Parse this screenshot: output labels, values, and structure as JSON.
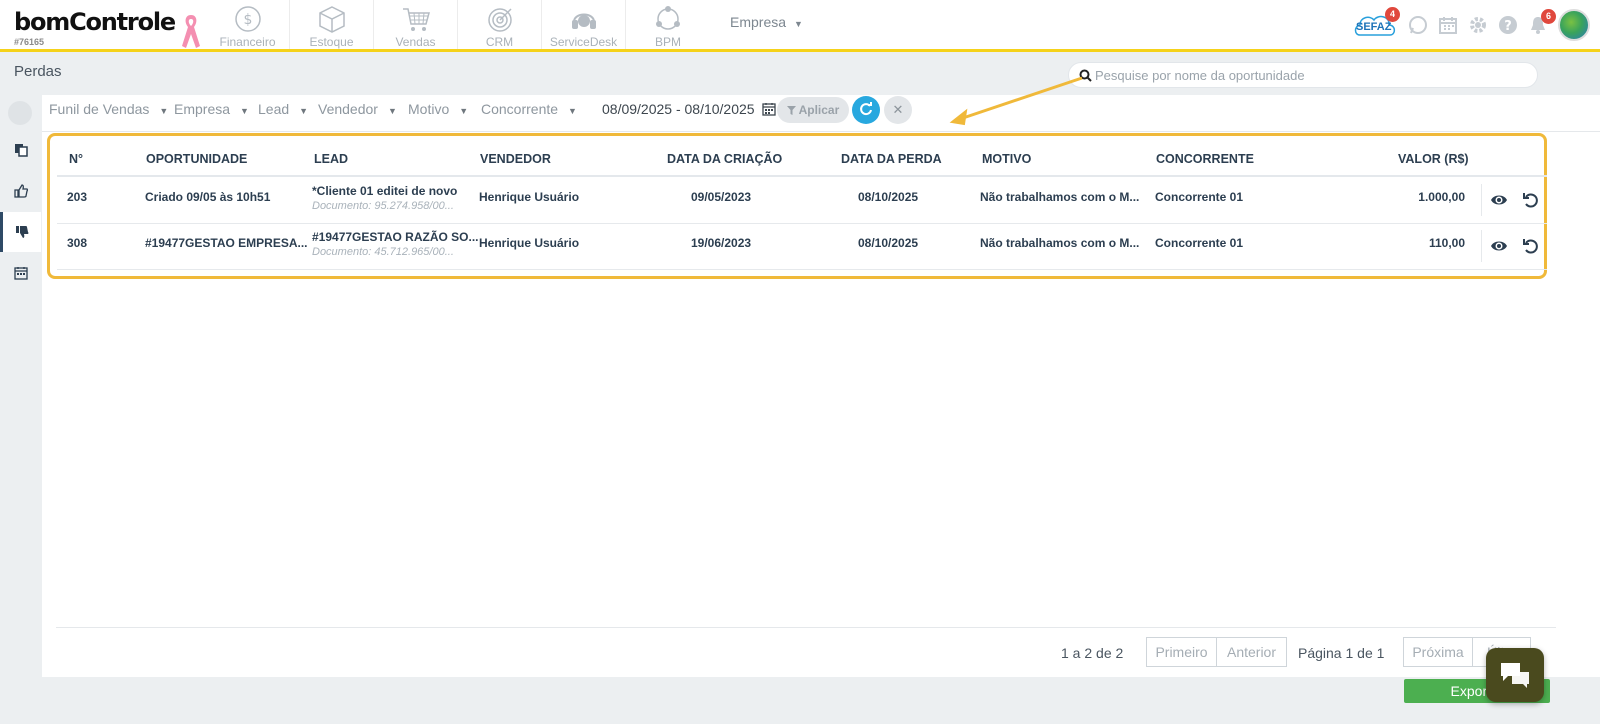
{
  "header": {
    "logo": "bomControle",
    "account_id": "#76165",
    "modules": [
      {
        "label": "Financeiro",
        "icon": "dollar-circle-icon"
      },
      {
        "label": "Estoque",
        "icon": "box-icon"
      },
      {
        "label": "Vendas",
        "icon": "cart-icon"
      },
      {
        "label": "CRM",
        "icon": "target-icon"
      },
      {
        "label": "ServiceDesk",
        "icon": "headset-icon"
      },
      {
        "label": "BPM",
        "icon": "process-icon"
      }
    ],
    "company_menu": "Empresa",
    "sefaz_label": "SEFAZ",
    "sefaz_badge": "4",
    "notifications_badge": "6"
  },
  "page": {
    "title": "Perdas",
    "search_placeholder": "Pesquise por nome da oportunidade"
  },
  "filters": {
    "funnel": "Funil de Vendas",
    "company": "Empresa",
    "lead": "Lead",
    "seller": "Vendedor",
    "reason": "Motivo",
    "competitor": "Concorrente",
    "date_range": "08/09/2025 - 08/10/2025",
    "apply": "Aplicar"
  },
  "table": {
    "columns": {
      "number": "N°",
      "opportunity": "OPORTUNIDADE",
      "lead": "LEAD",
      "seller": "VENDEDOR",
      "created": "DATA DA CRIAÇÃO",
      "lost": "DATA DA PERDA",
      "reason": "MOTIVO",
      "competitor": "CONCORRENTE",
      "value": "VALOR (R$)"
    },
    "rows": [
      {
        "number": "203",
        "opportunity": "Criado 09/05 às 10h51",
        "lead": "*Cliente 01 editei de novo",
        "lead_doc": "Documento: 95.274.958/00...",
        "seller": "Henrique Usuário",
        "created": "09/05/2023",
        "lost": "08/10/2025",
        "reason": "Não trabalhamos com o M...",
        "competitor": "Concorrente 01",
        "value": "1.000,00"
      },
      {
        "number": "308",
        "opportunity": "#19477GESTAO EMPRESA...",
        "lead": "#19477GESTAO RAZÃO SO...",
        "lead_doc": "Documento: 45.712.965/00...",
        "seller": "Henrique Usuário",
        "created": "19/06/2023",
        "lost": "08/10/2025",
        "reason": "Não trabalhamos com o M...",
        "competitor": "Concorrente 01",
        "value": "110,00"
      }
    ]
  },
  "pagination": {
    "count": "1 a 2 de 2",
    "first": "Primeiro",
    "prev": "Anterior",
    "page_info": "Página 1 de 1",
    "next": "Próxima",
    "last": "Últ..."
  },
  "export_label": "Exportar",
  "colors": {
    "accent_yellow": "#f5d21a",
    "highlight_border": "#f0b93a",
    "export_green": "#4caf50",
    "refresh_blue": "#28a8df",
    "badge_red": "#e0483d"
  }
}
